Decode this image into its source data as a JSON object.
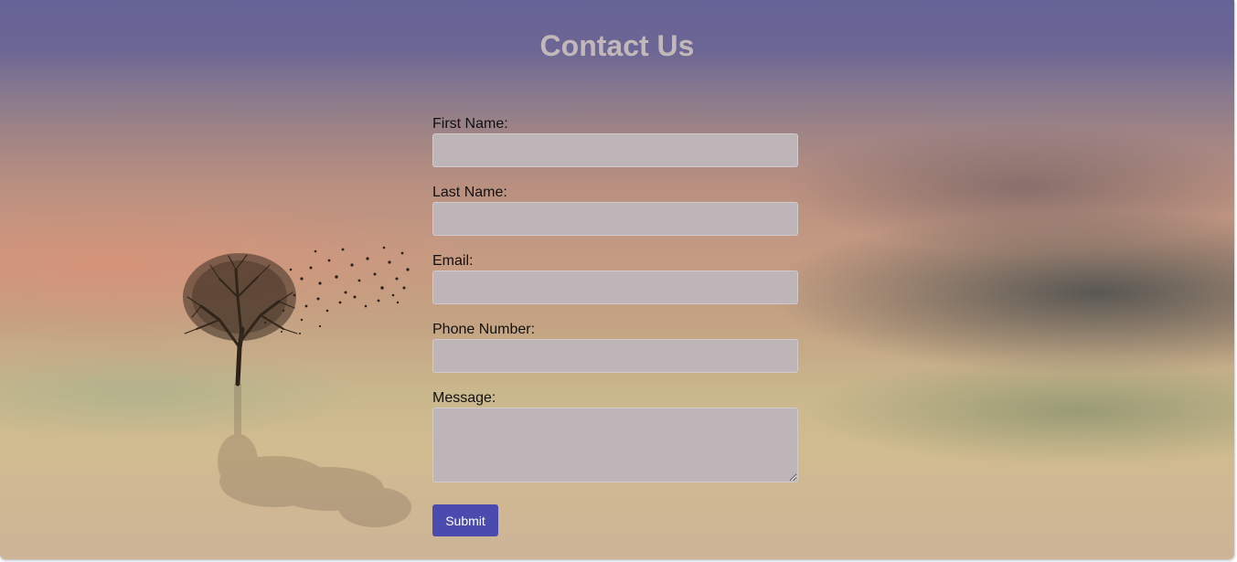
{
  "page": {
    "title": "Contact Us"
  },
  "form": {
    "fields": [
      {
        "label": "First Name:",
        "value": ""
      },
      {
        "label": "Last Name:",
        "value": ""
      },
      {
        "label": "Email:",
        "value": ""
      },
      {
        "label": "Phone Number:",
        "value": ""
      },
      {
        "label": "Message:",
        "value": ""
      }
    ],
    "submit_label": "Submit"
  },
  "colors": {
    "accent": "#4b4aaf",
    "input_background": "#bdb5b8",
    "title_text": "#c2b8ba",
    "sky_top": "#666396"
  },
  "background": {
    "icon": "tree-with-birds-icon"
  }
}
